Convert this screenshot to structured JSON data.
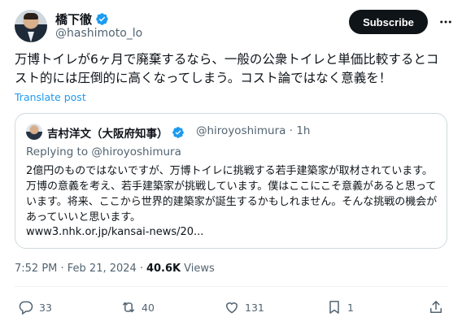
{
  "author": {
    "name": "橋下徹",
    "handle": "@hashimoto_lo"
  },
  "header": {
    "subscribe_label": "Subscribe",
    "more_icon": "more-icon"
  },
  "tweet": {
    "text": "万博トイレが6ヶ月で廃棄するなら、一般の公衆トイレと単価比較するとコスト的には圧倒的に高くなってしまう。コスト論ではなく意義を！",
    "translate_label": "Translate post"
  },
  "quote": {
    "name": "吉村洋文（大阪府知事）",
    "handle": "@hiroyoshimura · 1h",
    "replying_prefix": "Replying to",
    "replying_handle": "@hiroyoshimura",
    "text": "2億円のものではないですが、万博トイレに挑戦する若手建築家が取材されています。万博の意義を考え、若手建築家が挑戦しています。僕はここにこそ意義があると思っています。将来、ここから世界的建築家が誕生するかもしれません。そんな挑戦の機会があっていいと思います。",
    "link": "www3.nhk.or.jp/kansai-news/20..."
  },
  "meta": {
    "timestamp": "7:52 PM · Feb 21, 2024",
    "separator": "·",
    "views_count": "40.6K",
    "views_label": "Views"
  },
  "actions": {
    "replies": "33",
    "reposts": "40",
    "likes": "131",
    "bookmarks": "1"
  },
  "colors": {
    "accent": "#1d9bf0",
    "text": "#0f1419",
    "secondary": "#536471",
    "border": "#cfd9de"
  }
}
